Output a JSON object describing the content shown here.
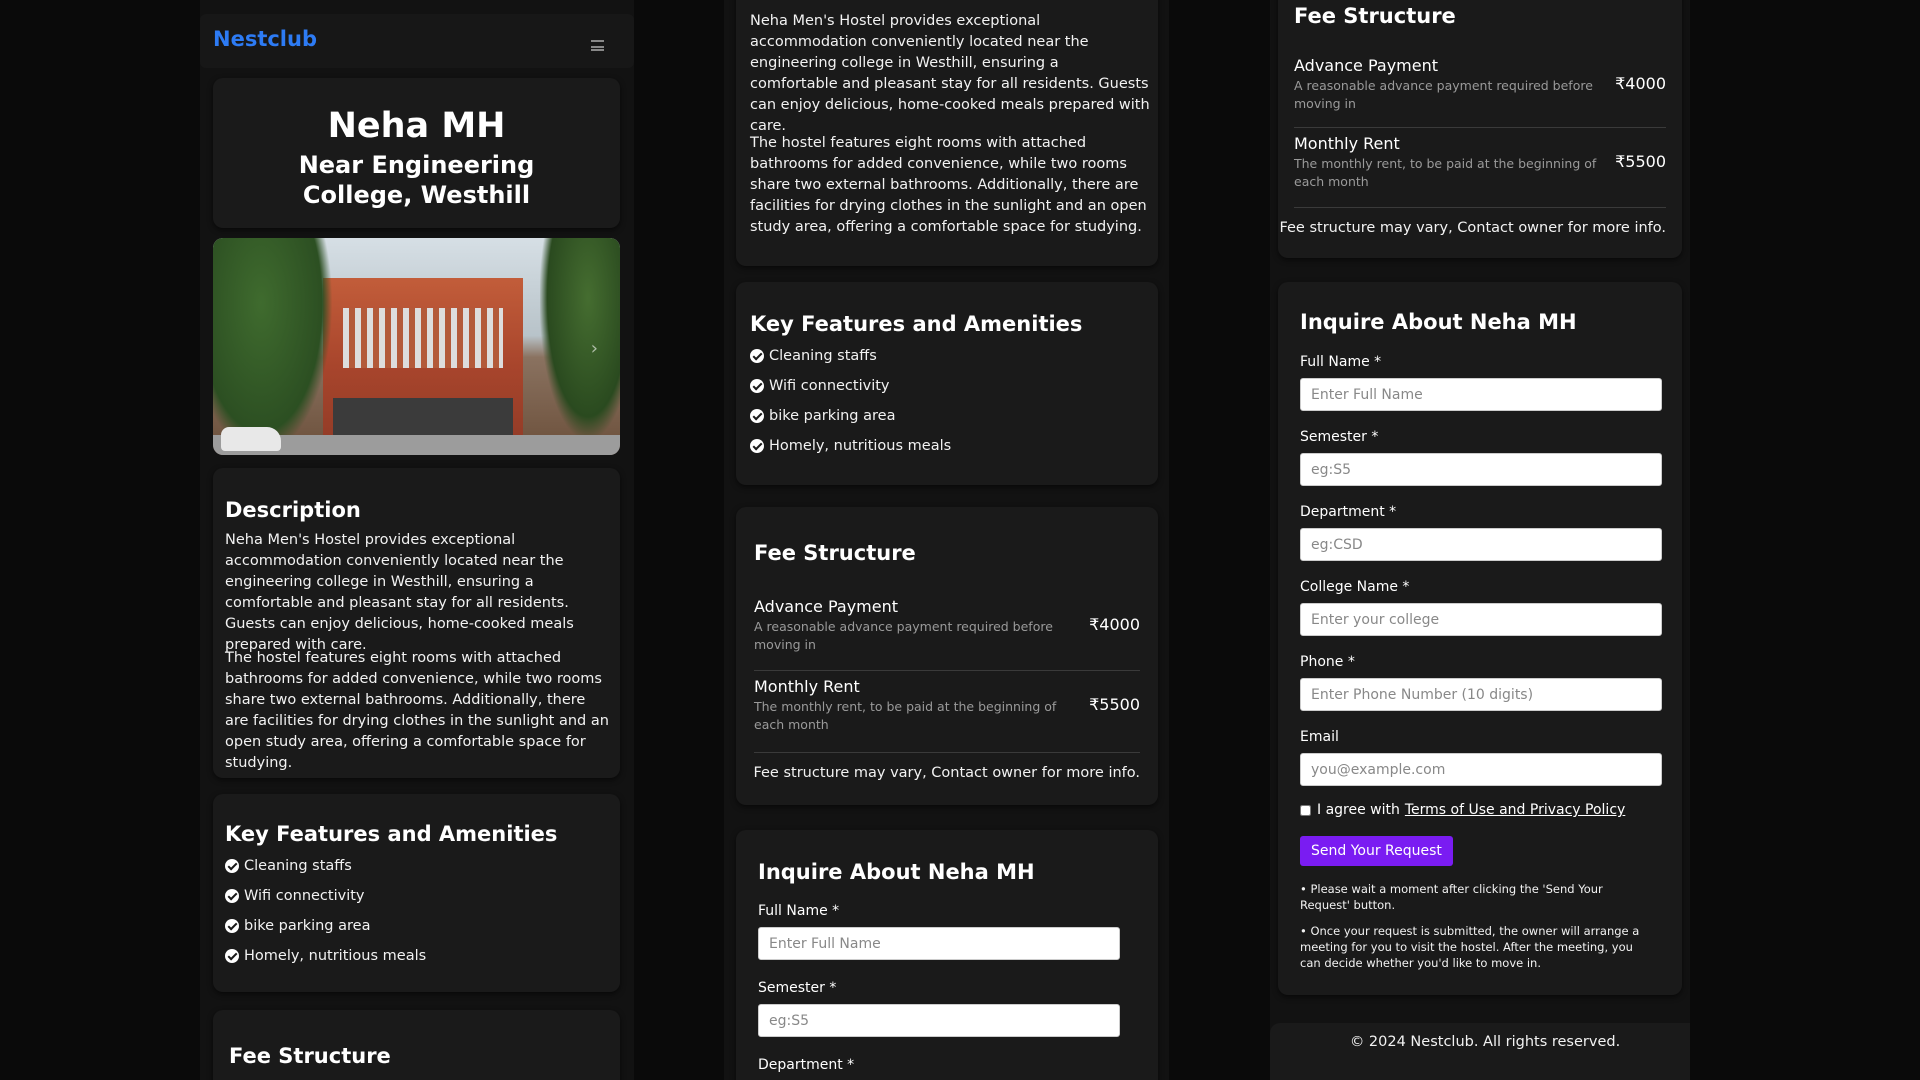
{
  "nav": {
    "brand": "Nestclub"
  },
  "hostel": {
    "name": "Neha MH",
    "location": "Near Engineering College, Westhill"
  },
  "description": {
    "title": "Description",
    "p1": "Neha Men's Hostel provides exceptional accommodation conveniently located near the engineering college in Westhill, ensuring a comfortable and pleasant stay for all residents. Guests can enjoy delicious, home-cooked meals prepared with care.",
    "p2": "The hostel features eight rooms with attached bathrooms for added convenience, while two rooms share two external bathrooms. Additionally, there are facilities for drying clothes in the sunlight and an open study area, offering a comfortable space for studying."
  },
  "features": {
    "title": "Key Features and Amenities",
    "items": [
      "Cleaning staffs",
      "Wifi connectivity",
      "bike parking area",
      "Homely, nutritious meals"
    ]
  },
  "fees": {
    "title": "Fee Structure",
    "items": [
      {
        "label": "Advance Payment",
        "desc": "A reasonable advance payment required before moving in",
        "amount": "₹4000"
      },
      {
        "label": "Monthly Rent",
        "desc": "The monthly rent, to be paid at the beginning of each month",
        "amount": "₹5500"
      }
    ],
    "note": "Fee structure may vary, Contact owner for more info."
  },
  "inquiry": {
    "title": "Inquire About Neha MH",
    "fields": [
      {
        "label": "Full Name *",
        "placeholder": "Enter Full Name"
      },
      {
        "label": "Semester *",
        "placeholder": "eg:S5"
      },
      {
        "label": "Department *",
        "placeholder": "eg:CSD"
      },
      {
        "label": "College Name *",
        "placeholder": "Enter your college"
      },
      {
        "label": "Phone *",
        "placeholder": "Enter Phone Number (10 digits)"
      },
      {
        "label": "Email",
        "placeholder": "you@example.com"
      }
    ],
    "agree_text": "I agree with",
    "terms_link": "Terms of Use and Privacy Policy",
    "submit": "Send Your Request",
    "notes": [
      "• Please wait a moment after clicking the 'Send Your Request' button.",
      "• Once your request is submitted, the owner will arrange a meeting for you to visit the hostel. After the meeting, you can decide whether you'd like to move in."
    ]
  },
  "footer": {
    "text": "© 2024 Nestclub. All rights reserved."
  },
  "colors": {
    "brand": "#2d7bf4",
    "button": "#7a1cf2",
    "background": "#0a0a0a",
    "card": "#1a1a1a"
  },
  "icons": {
    "menu": "hamburger-menu-icon",
    "check": "check-circle-icon",
    "carousel_next": "chevron-right-icon"
  }
}
